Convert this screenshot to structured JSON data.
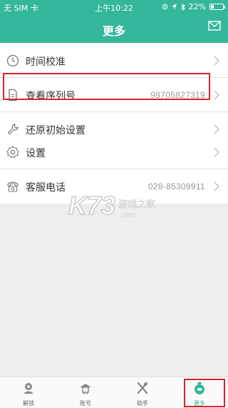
{
  "status_bar": {
    "carrier": "无 SIM 卡",
    "time": "上午10:22",
    "battery": "22%",
    "battery_level": 0.22
  },
  "header": {
    "title": "更多",
    "mail_icon": "mail-icon"
  },
  "settings": {
    "group1": [
      {
        "label": "时间校准",
        "value": "",
        "icon": "clock-icon"
      },
      {
        "label": "查看序列号",
        "value": "98705827319",
        "icon": "document-icon"
      },
      {
        "label": "还原初始设置",
        "value": "",
        "icon": "wrench-icon"
      }
    ],
    "group2": [
      {
        "label": "设置",
        "value": "",
        "icon": "gear-icon"
      },
      {
        "label": "客服电话",
        "value": "028-85309911",
        "icon": "phone-icon"
      }
    ]
  },
  "watermark": {
    "logo": "K73",
    "text": "游戏之家",
    "url": ".com"
  },
  "tabbar": {
    "tabs": [
      {
        "label": "解锁",
        "icon": "unlock-icon"
      },
      {
        "label": "账号",
        "icon": "account-icon"
      },
      {
        "label": "助手",
        "icon": "assistant-icon"
      },
      {
        "label": "更多",
        "icon": "more-icon"
      }
    ],
    "active_index": 3
  },
  "colors": {
    "primary": "#34b79a",
    "highlight": "#d9232d"
  }
}
